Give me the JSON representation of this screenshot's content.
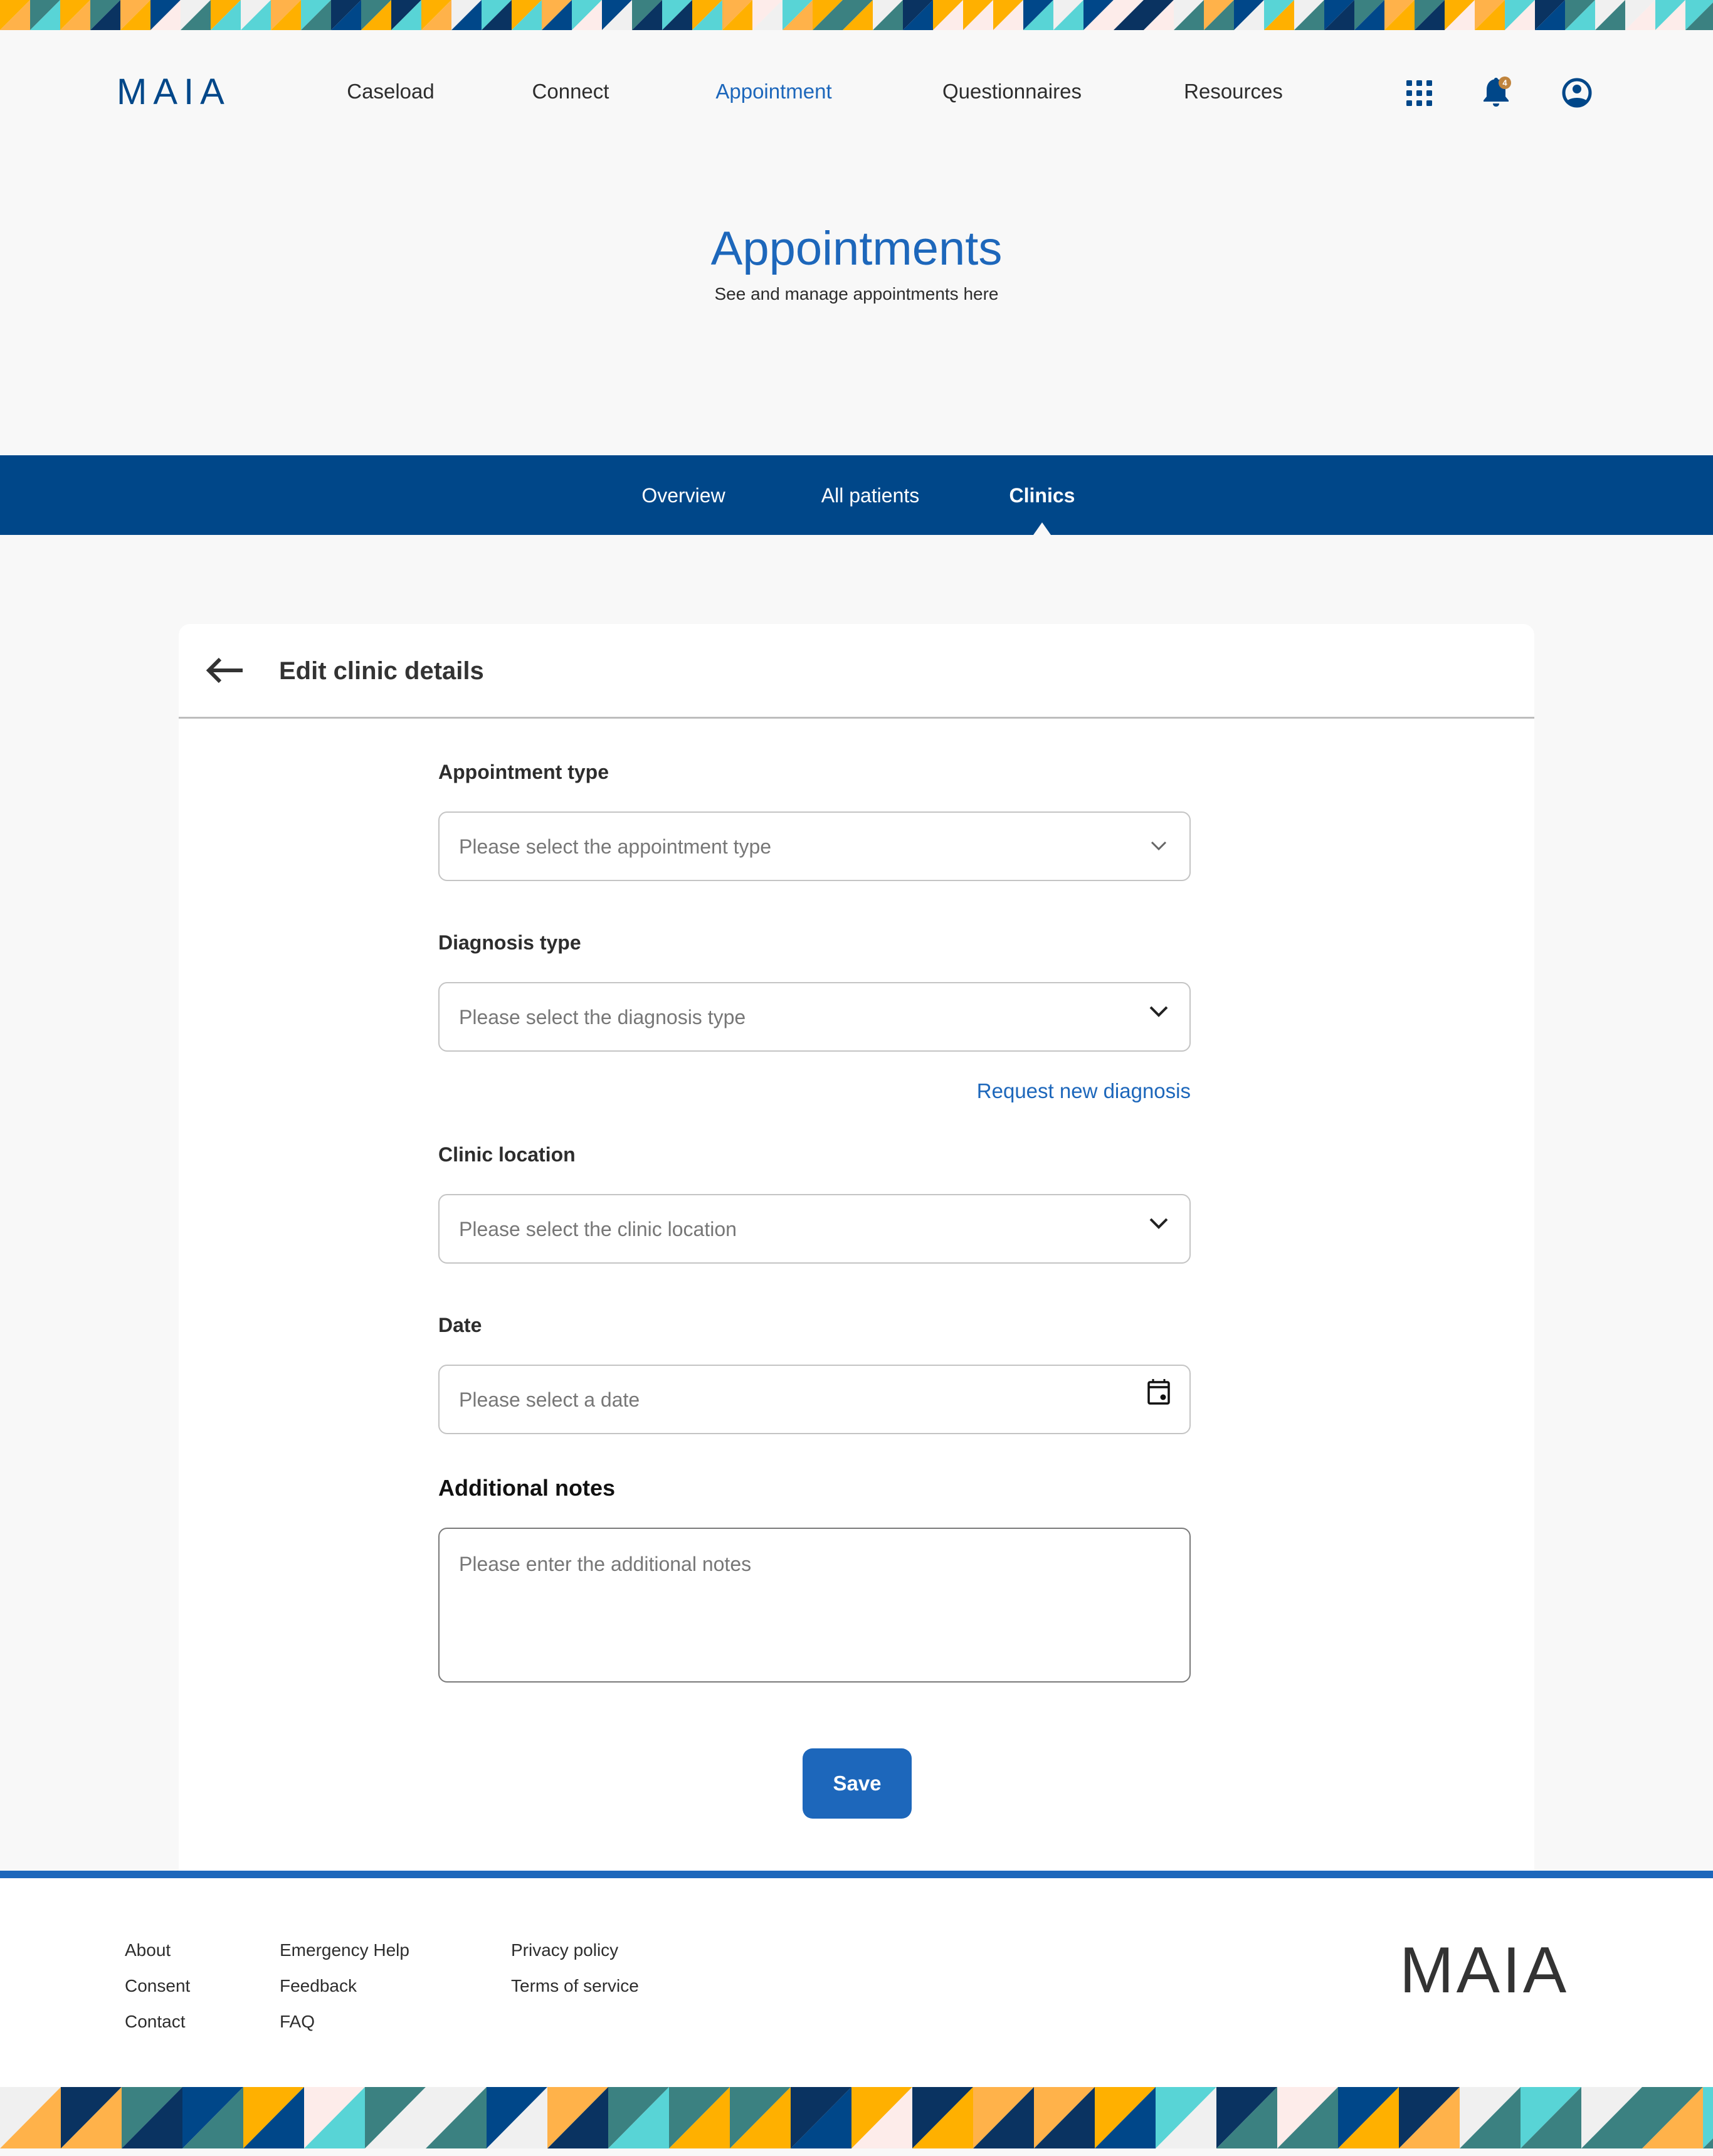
{
  "header": {
    "logo": "MAIA",
    "nav": [
      {
        "label": "Caseload",
        "active": false
      },
      {
        "label": "Connect",
        "active": false
      },
      {
        "label": "Appointment",
        "active": true
      },
      {
        "label": "Questionnaires",
        "active": false
      },
      {
        "label": "Resources",
        "active": false
      }
    ],
    "icons": {
      "apps": "grid-icon",
      "notifications": "bell-icon",
      "profile": "user-circle-icon"
    },
    "notification_count": "4"
  },
  "hero": {
    "title": "Appointments",
    "subtitle": "See and manage appointments here"
  },
  "tabs": [
    {
      "label": "Overview",
      "active": false
    },
    {
      "label": "All patients",
      "active": false
    },
    {
      "label": "Clinics",
      "active": true
    }
  ],
  "card": {
    "title": "Edit clinic details",
    "back_icon": "arrow-left-icon",
    "fields": {
      "appointment_type": {
        "label": "Appointment type",
        "placeholder": "Please select the appointment type",
        "icon": "chevron-down-icon"
      },
      "diagnosis_type": {
        "label": "Diagnosis type",
        "placeholder": "Please select the diagnosis type",
        "icon": "chevron-down-icon"
      },
      "request_link": "Request new diagnosis",
      "clinic_location": {
        "label": "Clinic location",
        "placeholder": "Please select the clinic location",
        "icon": "chevron-down-icon"
      },
      "date": {
        "label": "Date",
        "placeholder": "Please select a date",
        "icon": "calendar-icon"
      },
      "additional_notes": {
        "label": "Additional notes",
        "placeholder": "Please enter the additional notes"
      }
    },
    "save_label": "Save"
  },
  "footer": {
    "columns": [
      [
        "About",
        "Consent",
        "Contact"
      ],
      [
        "Emergency Help",
        "Feedback",
        "FAQ"
      ],
      [
        "Privacy policy",
        "Terms of service"
      ]
    ],
    "logo": "MAIA"
  },
  "colors": {
    "brand_dark": "#004789",
    "brand_accent": "#1d67bb",
    "badge": "#c0843d",
    "stripe_palette": [
      "#3b8181",
      "#58d4d6",
      "#004789",
      "#ffb000",
      "#ffb24a",
      "#f0f0f0",
      "#fdecea",
      "#0a3361"
    ]
  }
}
